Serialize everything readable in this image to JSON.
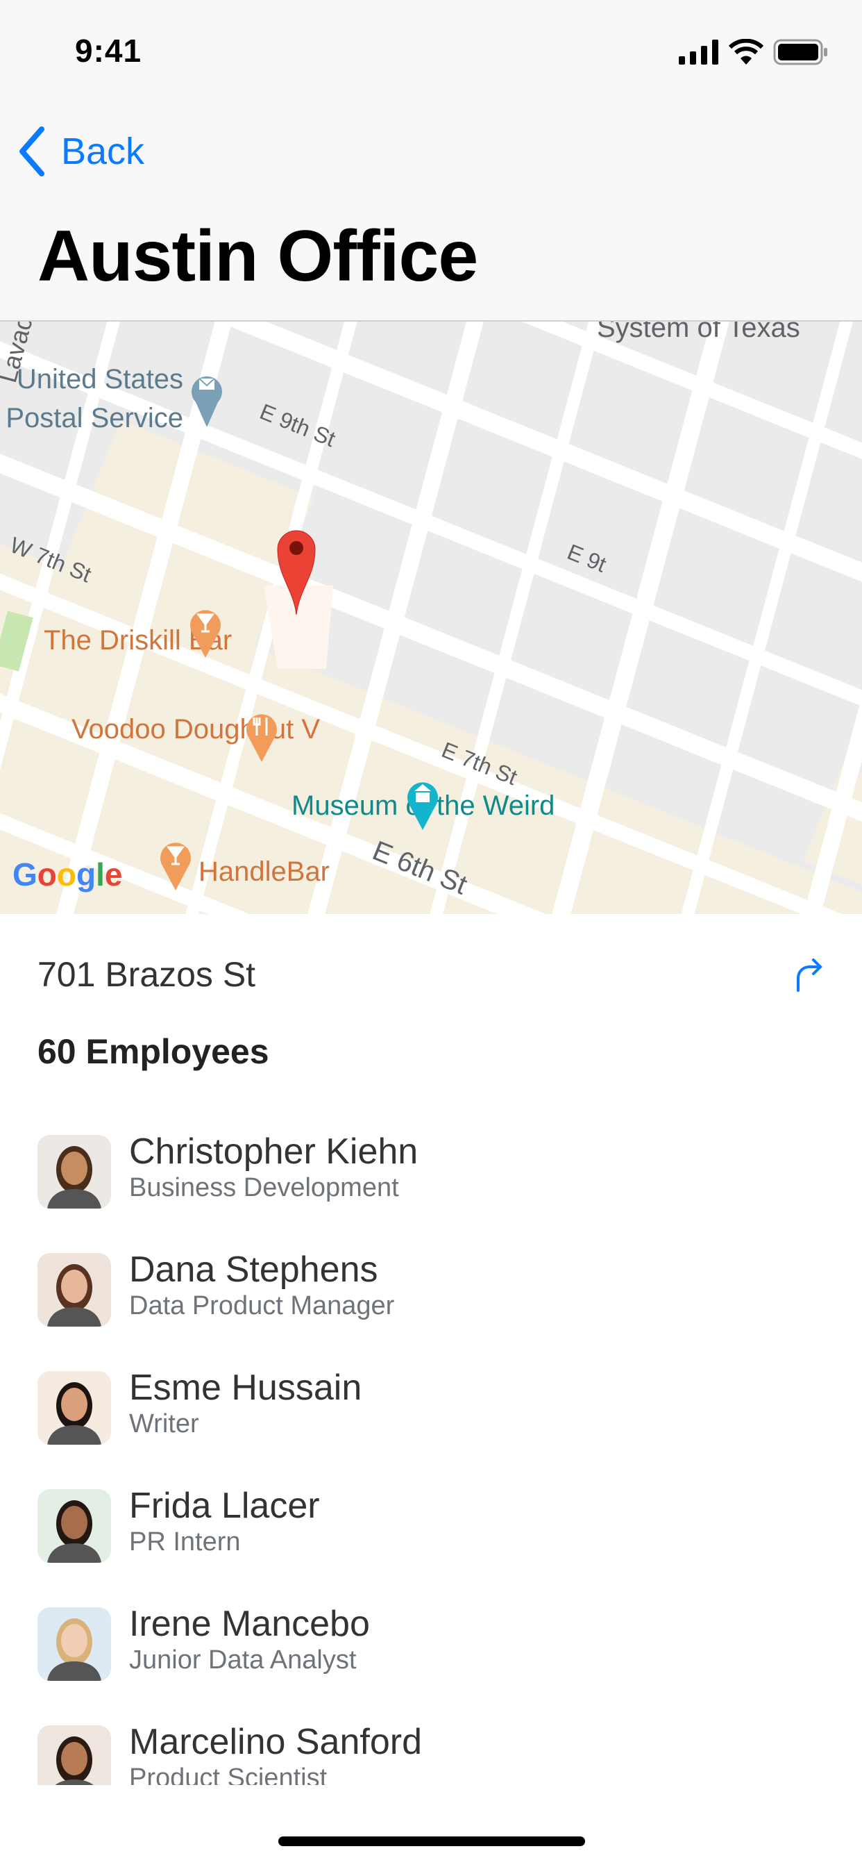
{
  "status_bar": {
    "time": "9:41"
  },
  "nav": {
    "back_label": "Back",
    "title": "Austin Office"
  },
  "map": {
    "labels": {
      "system_of_texas": "System of Texas",
      "usps_line1": "United States",
      "usps_line2": "Postal Service",
      "e9th": "E 9th St",
      "e9th_right": "E 9t",
      "w7th": "W 7th St",
      "e7th": "E 7th St",
      "e6th": "E 6th St",
      "lavaca": "Lavac",
      "driskill": "The Driskill Bar",
      "voodoo": "Voodoo Doughnut V",
      "museum": "Museum of the Weird",
      "handlebar": "HandleBar",
      "google": "Google"
    },
    "colors": {
      "pin": "#ea4335",
      "poi_food": "#f29c5b",
      "poi_museum": "#12b5cb",
      "poi_post": "#7aa0b5",
      "block": "#f5efe0",
      "base": "#ebebeb"
    }
  },
  "details": {
    "address": "701 Brazos St",
    "employee_count": "60 Employees"
  },
  "employees": [
    {
      "name": "Christopher Kiehn",
      "role": "Business Development",
      "bg": "#ece9e4",
      "skin": "#c68d62",
      "hair": "#4a2e1c"
    },
    {
      "name": "Dana Stephens",
      "role": "Data Product Manager",
      "bg": "#efe4dc",
      "skin": "#e7b79a",
      "hair": "#5a3222"
    },
    {
      "name": "Esme Hussain",
      "role": "Writer",
      "bg": "#f6ebe0",
      "skin": "#d9a07b",
      "hair": "#1c1410"
    },
    {
      "name": "Frida Llacer",
      "role": "PR Intern",
      "bg": "#e3efe4",
      "skin": "#a66e4c",
      "hair": "#231711"
    },
    {
      "name": "Irene Mancebo",
      "role": "Junior Data Analyst",
      "bg": "#dde9f3",
      "skin": "#f0cdb4",
      "hair": "#d9b27a"
    },
    {
      "name": "Marcelino Sanford",
      "role": "Product Scientist",
      "bg": "#efe6df",
      "skin": "#b77c56",
      "hair": "#2a1a12"
    }
  ]
}
